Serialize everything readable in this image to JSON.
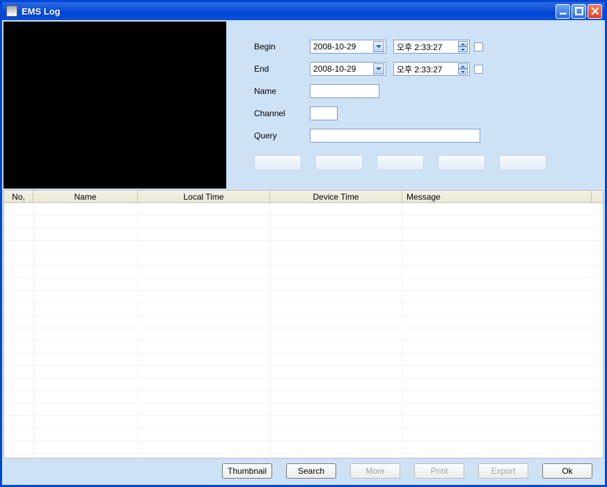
{
  "window": {
    "title": "EMS Log"
  },
  "form": {
    "begin": {
      "label": "Begin",
      "date": "2008-10-29",
      "time": "오후  2:33:27"
    },
    "end": {
      "label": "End",
      "date": "2008-10-29",
      "time": "오후  2:33:27"
    },
    "name": {
      "label": "Name",
      "value": ""
    },
    "channel": {
      "label": "Channel",
      "value": ""
    },
    "query": {
      "label": "Query",
      "value": ""
    }
  },
  "grid": {
    "headers": {
      "no": "No,",
      "name": "Name",
      "local_time": "Local Time",
      "device_time": "Device Time",
      "message": "Message"
    },
    "rows": []
  },
  "buttons": {
    "thumbnail": "Thumbnail",
    "search": "Search",
    "more": "More",
    "print": "Print",
    "export": "Export",
    "ok": "Ok"
  }
}
